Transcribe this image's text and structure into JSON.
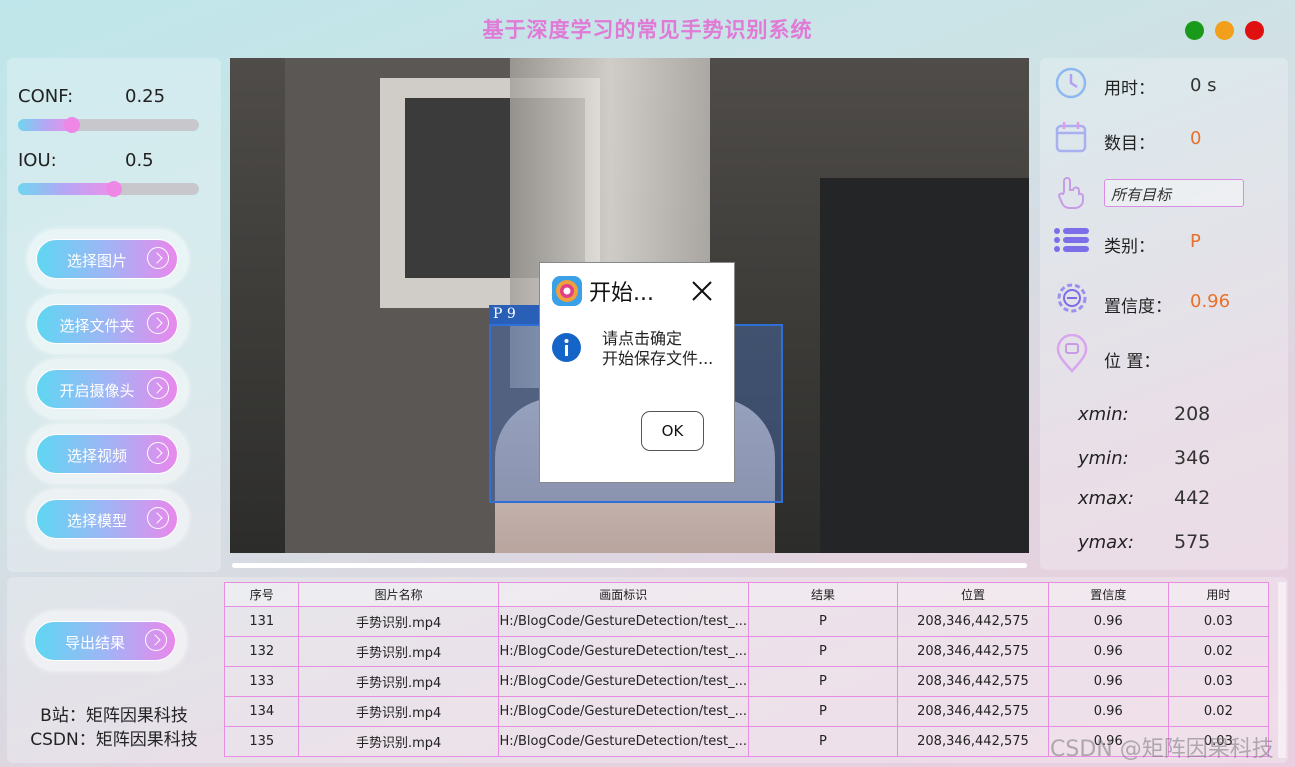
{
  "window": {
    "title": "基于深度学习的常见手势识别系统",
    "controls": [
      {
        "name": "green",
        "color": "#1a9a1a"
      },
      {
        "name": "orange",
        "color": "#f2a01b"
      },
      {
        "name": "red",
        "color": "#e01010"
      }
    ]
  },
  "left": {
    "conf_label": "CONF:",
    "conf_value": "0.25",
    "conf_slider": 0.25,
    "iou_label": "IOU:",
    "iou_value": "0.5",
    "iou_slider": 0.5,
    "buttons": [
      "选择图片",
      "选择文件夹",
      "开启摄像头",
      "选择视频",
      "选择模型"
    ],
    "export_label": "导出结果",
    "credit_bili": "B站：矩阵因果科技",
    "credit_csdn": "CSDN：矩阵因果科技"
  },
  "video": {
    "det_label": "P  9",
    "det_icon": "arrow-cursor-icon"
  },
  "dialog": {
    "title": "开始...",
    "line1": "请点击确定",
    "line2": "开始保存文件...",
    "ok_label": "OK",
    "icon": "info-icon"
  },
  "right": {
    "time_label": "用时：",
    "time_value": "0 s",
    "count_label": "数目：",
    "count_value": "0",
    "target_select": "所有目标",
    "class_label": "类别：",
    "class_value": "P",
    "conf_label": "置信度：",
    "conf_value": "0.96",
    "pos_label": "位 置：",
    "xmin_label": "xmin:",
    "xmin": "208",
    "ymin_label": "ymin:",
    "ymin": "346",
    "xmax_label": "xmax:",
    "xmax": "442",
    "ymax_label": "ymax:",
    "ymax": "575",
    "accent_color": "#e8702a"
  },
  "table": {
    "headers": [
      "序号",
      "图片名称",
      "画面标识",
      "结果",
      "位置",
      "置信度",
      "用时"
    ],
    "rows": [
      [
        "131",
        "手势识别.mp4",
        "H:/BlogCode/GestureDetection/test_...",
        "P",
        "208,346,442,575",
        "0.96",
        "0.03"
      ],
      [
        "132",
        "手势识别.mp4",
        "H:/BlogCode/GestureDetection/test_...",
        "P",
        "208,346,442,575",
        "0.96",
        "0.02"
      ],
      [
        "133",
        "手势识别.mp4",
        "H:/BlogCode/GestureDetection/test_...",
        "P",
        "208,346,442,575",
        "0.96",
        "0.03"
      ],
      [
        "134",
        "手势识别.mp4",
        "H:/BlogCode/GestureDetection/test_...",
        "P",
        "208,346,442,575",
        "0.96",
        "0.02"
      ],
      [
        "135",
        "手势识别.mp4",
        "H:/BlogCode/GestureDetection/test_...",
        "P",
        "208,346,442,575",
        "0.96",
        "0.03"
      ]
    ]
  },
  "watermark": "CSDN @矩阵因果科技"
}
